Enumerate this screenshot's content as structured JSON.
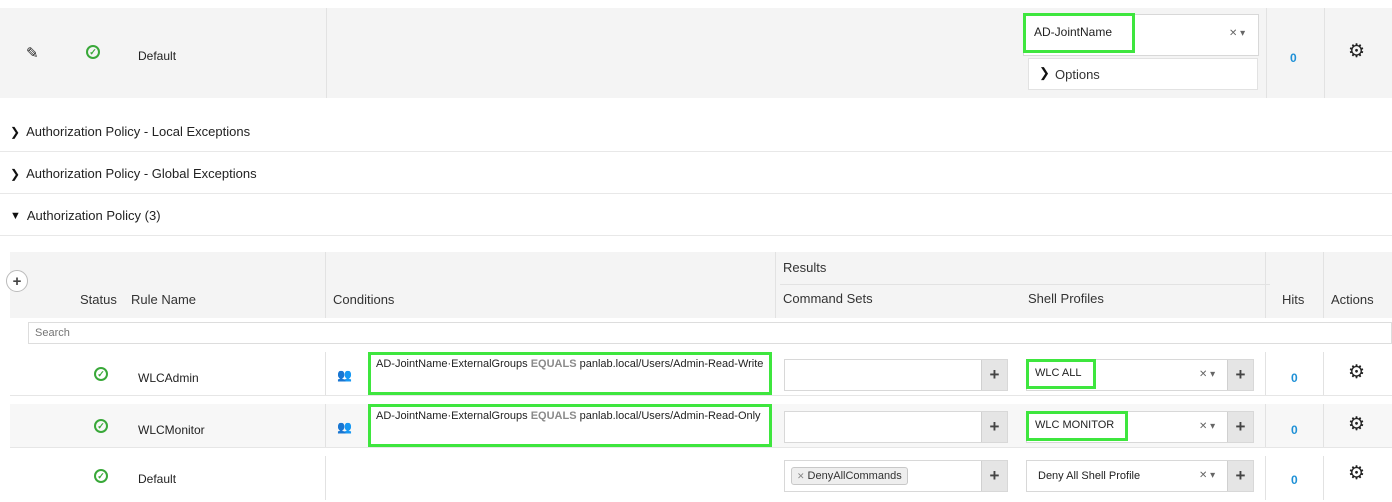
{
  "top_default_row": {
    "rule_name": "Default",
    "identity_source": "AD-JointName",
    "options_label": "Options",
    "hits": "0"
  },
  "sections": [
    {
      "label": "Authorization Policy - Local Exceptions",
      "expanded": false
    },
    {
      "label": "Authorization Policy - Global Exceptions",
      "expanded": false
    },
    {
      "label": "Authorization Policy (3)",
      "expanded": true
    }
  ],
  "table": {
    "headers": {
      "status": "Status",
      "rule_name": "Rule Name",
      "conditions": "Conditions",
      "results": "Results",
      "command_sets": "Command Sets",
      "shell_profiles": "Shell Profiles",
      "hits": "Hits",
      "actions": "Actions"
    },
    "search_placeholder": "Search",
    "rows": [
      {
        "rule_name": "WLCAdmin",
        "condition_attr": "AD-JointName·ExternalGroups",
        "condition_op": "EQUALS",
        "condition_value": "panlab.local/Users/Admin-Read-Write",
        "command_set": "",
        "shell_profile": "WLC ALL",
        "hits": "0"
      },
      {
        "rule_name": "WLCMonitor",
        "condition_attr": "AD-JointName·ExternalGroups",
        "condition_op": "EQUALS",
        "condition_value": "panlab.local/Users/Admin-Read-Only",
        "command_set": "",
        "shell_profile": "WLC MONITOR",
        "hits": "0"
      },
      {
        "rule_name": "Default",
        "command_set": "DenyAllCommands",
        "shell_profile": "Deny All Shell Profile",
        "hits": "0"
      }
    ]
  },
  "colors": {
    "highlight": "#3ee63e",
    "status_ok": "#39a839",
    "hits": "#1e90d6"
  }
}
